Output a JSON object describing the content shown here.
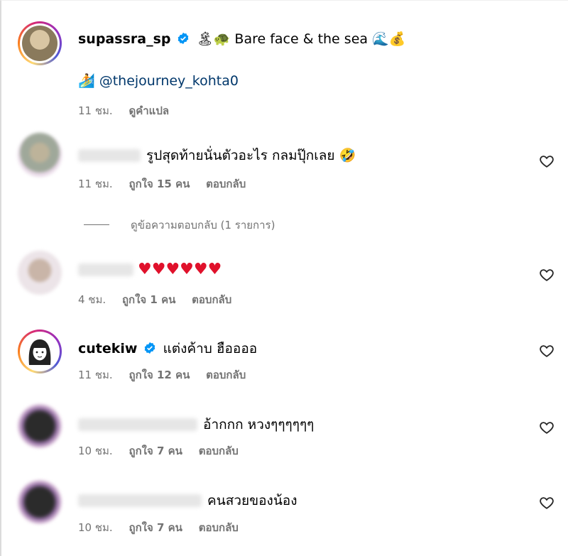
{
  "post": {
    "username": "supassra_sp",
    "caption_lead": "🏝🐢",
    "caption": "Bare face & the sea",
    "caption_tail": "🌊💰",
    "tag_emoji": "🏄",
    "mention": "@thejourney_kohta0",
    "time": "11 ชม.",
    "translate": "ดูคำแปล"
  },
  "comments": [
    {
      "username": "",
      "text": "รูปสุดท้ายนั่นตัวอะไร กลมปุ๊กเลย",
      "emoji": "🤣",
      "time": "11 ชม.",
      "likes": "ถูกใจ 15 คน",
      "reply": "ตอบกลับ"
    },
    {
      "username": "",
      "text": "♥♥♥♥♥♥",
      "time": "4 ชม.",
      "likes": "ถูกใจ 1 คน",
      "reply": "ตอบกลับ"
    },
    {
      "username": "cutekiw",
      "text": "แต่งค้าบ ฮืออออ",
      "time": "11 ชม.",
      "likes": "ถูกใจ 12 คน",
      "reply": "ตอบกลับ"
    },
    {
      "username": "",
      "text": "อ้ากกก หวงๆๆๆๆๆๆ",
      "time": "10 ชม.",
      "likes": "ถูกใจ 7 คน",
      "reply": "ตอบกลับ"
    },
    {
      "username": "",
      "text": "คนสวยของน้อง",
      "time": "10 ชม.",
      "likes": "ถูกใจ 7 คน",
      "reply": "ตอบกลับ"
    }
  ],
  "view_replies": "ดูข้อความตอบกลับ (1 รายการ)",
  "colors": {
    "text": "#000000",
    "muted": "#737373",
    "mention": "#00376b",
    "verified": "#0095f6",
    "heart": "#e0112b"
  },
  "icons": [
    "verified-badge-icon",
    "heart-outline-icon"
  ]
}
